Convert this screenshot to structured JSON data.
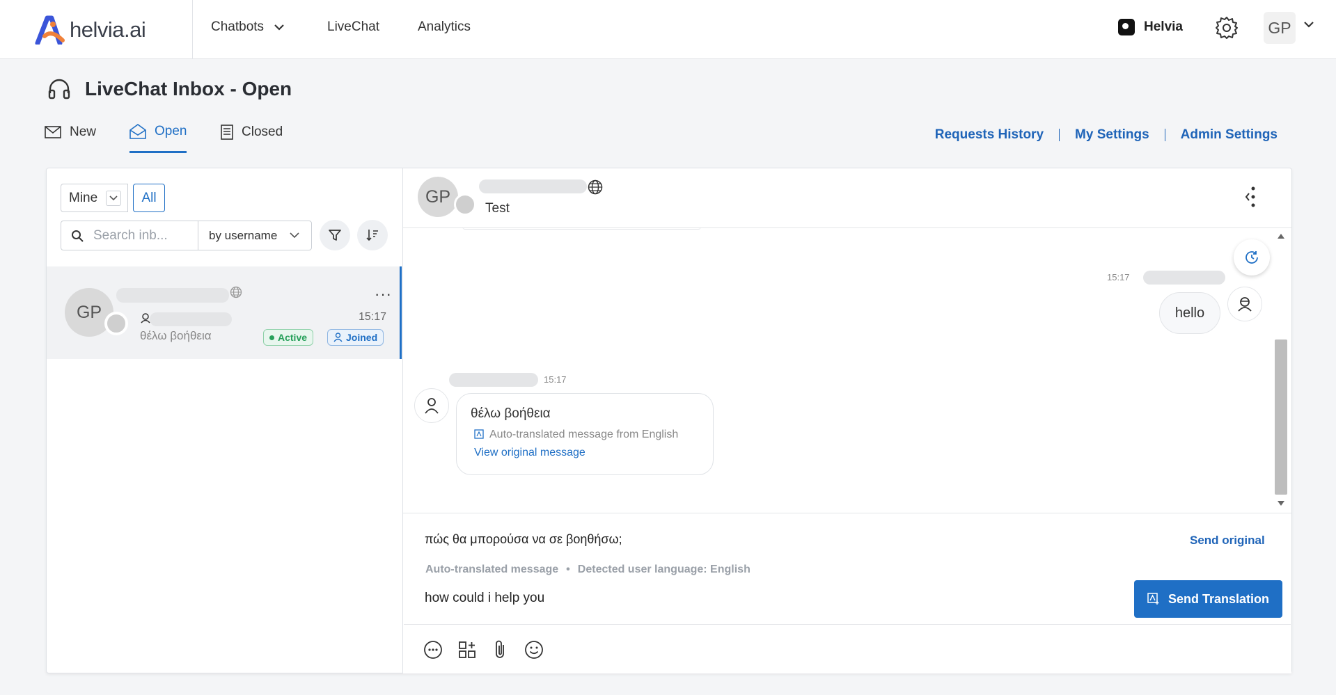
{
  "brand": {
    "logo_text": "helvia.ai",
    "workspace_name": "Helvia",
    "user_initials": "GP"
  },
  "nav": {
    "chatbots": "Chatbots",
    "livechat": "LiveChat",
    "analytics": "Analytics"
  },
  "page": {
    "title": "LiveChat Inbox - Open"
  },
  "tabs": [
    {
      "label": "New"
    },
    {
      "label": "Open"
    },
    {
      "label": "Closed"
    }
  ],
  "top_links": {
    "requests_history": "Requests History",
    "my_settings": "My Settings",
    "admin_settings": "Admin Settings"
  },
  "filters": {
    "mine_label": "Mine",
    "all_label": "All",
    "search_placeholder": "Search inb...",
    "sort_by": "by username"
  },
  "conversation": {
    "initials": "GP",
    "time": "15:17",
    "preview": "θέλω βοήθεια",
    "badge_active": "Active",
    "badge_joined": "Joined"
  },
  "chat_header": {
    "initials": "GP",
    "subtitle": "Test"
  },
  "messages": {
    "outgoing": {
      "time": "15:17",
      "text": "hello"
    },
    "incoming": {
      "time": "15:17",
      "text": "θέλω βοήθεια",
      "translated_note": "Auto-translated message from English",
      "view_original": "View original message"
    }
  },
  "composer": {
    "translated_text": "πώς θα μπορούσα να σε βοηθήσω;",
    "send_original": "Send original",
    "auto_translated_label": "Auto-translated message",
    "bullet": "•",
    "detected_language": "Detected user language: English",
    "original_text": "how could i help you",
    "send_translation": "Send Translation"
  },
  "colors": {
    "accent": "#1f6fc5",
    "active_green": "#27a05a",
    "logo_orange": "#f0813a",
    "logo_blue": "#3b55d9"
  }
}
